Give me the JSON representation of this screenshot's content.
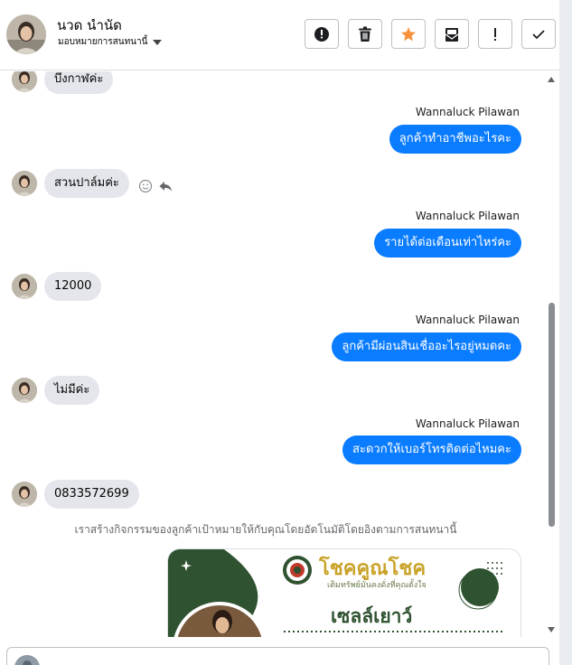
{
  "header": {
    "contact_name": "นวด นำนัด",
    "assign_label": "มอบหมายการสนทนานี้",
    "toolbar": [
      "mark-spam",
      "delete",
      "star",
      "mark-unread",
      "follow-up",
      "done"
    ]
  },
  "thread": {
    "messages": [
      {
        "dir": "in",
        "text": "บึงกาฬค่ะ"
      },
      {
        "dir": "out",
        "sender": "Wannaluck Pilawan",
        "text": "ลูกค้าทำอาชีพอะไรคะ"
      },
      {
        "dir": "in",
        "text": "สวนปาล์มค่ะ"
      },
      {
        "dir": "out",
        "sender": "Wannaluck Pilawan",
        "text": "รายได้ต่อเดือนเท่าไหร่คะ"
      },
      {
        "dir": "in",
        "text": "12000"
      },
      {
        "dir": "out",
        "sender": "Wannaluck Pilawan",
        "text": "ลูกค้ามีผ่อนสินเชื่ออะไรอยู่หมดคะ"
      },
      {
        "dir": "in",
        "text": "ไม่มีค่ะ"
      },
      {
        "dir": "out",
        "sender": "Wannaluck Pilawan",
        "text": "สะดวกให้เบอร์โทรติดต่อไหมคะ"
      },
      {
        "dir": "in",
        "text": "0833572699"
      }
    ],
    "system_note": "เราสร้างกิจกรรมของลูกค้าเป้าหมายให้กับคุณโดยอัตโนมัติโดยอิงตามการสนทนานี้"
  },
  "card": {
    "brand_title": "โชคคูณโชค",
    "brand_subtitle": "เติมทรัพย์มั่นคงดั่งที่คุณตั้งใจ",
    "headline": "เซลล์เยาว์"
  },
  "colors": {
    "outgoing": "#0a7cff",
    "incoming": "#e4e6eb",
    "star": "#f7923b",
    "card_green": "#2f5230"
  },
  "composer": {
    "text": "..."
  }
}
